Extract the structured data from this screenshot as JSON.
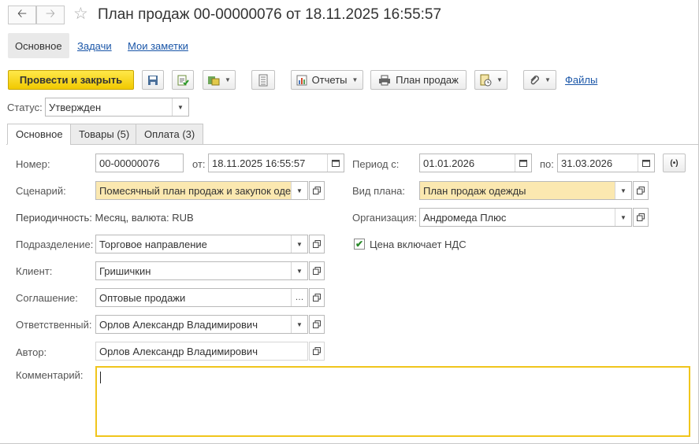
{
  "window": {
    "title": "План продаж 00-00000076 от 18.11.2025 16:55:57"
  },
  "top_tabs": [
    "Основное",
    "Задачи",
    "Мои заметки"
  ],
  "toolbar": {
    "post_close": "Провести и закрыть",
    "reports": "Отчеты",
    "sales_plan": "План продаж",
    "files": "Файлы"
  },
  "status": {
    "label": "Статус:",
    "value": "Утвержден"
  },
  "tabs": [
    "Основное",
    "Товары (5)",
    "Оплата (3)"
  ],
  "form": {
    "number_label": "Номер:",
    "number": "00-00000076",
    "from_label": "от:",
    "from_value": "18.11.2025 16:55:57",
    "period_label": "Период с:",
    "period_from": "01.01.2026",
    "period_to_label": "по:",
    "period_to": "31.03.2026",
    "scenario_label": "Сценарий:",
    "scenario": "Помесячный план продаж и закупок оде",
    "plan_type_label": "Вид плана:",
    "plan_type": "План продаж одежды",
    "periodicity": "Периодичность: Месяц, валюта: RUB",
    "org_label": "Организация:",
    "org": "Андромеда Плюс",
    "division_label": "Подразделение:",
    "division": "Торговое направление",
    "vat_label": "Цена включает НДС",
    "vat_checked": true,
    "client_label": "Клиент:",
    "client": "Гришичкин",
    "agreement_label": "Соглашение:",
    "agreement": "Оптовые продажи",
    "responsible_label": "Ответственный:",
    "responsible": "Орлов Александр Владимирович",
    "author_label": "Автор:",
    "author": "Орлов Александр Владимирович",
    "comment_label": "Комментарий:",
    "comment": ""
  }
}
